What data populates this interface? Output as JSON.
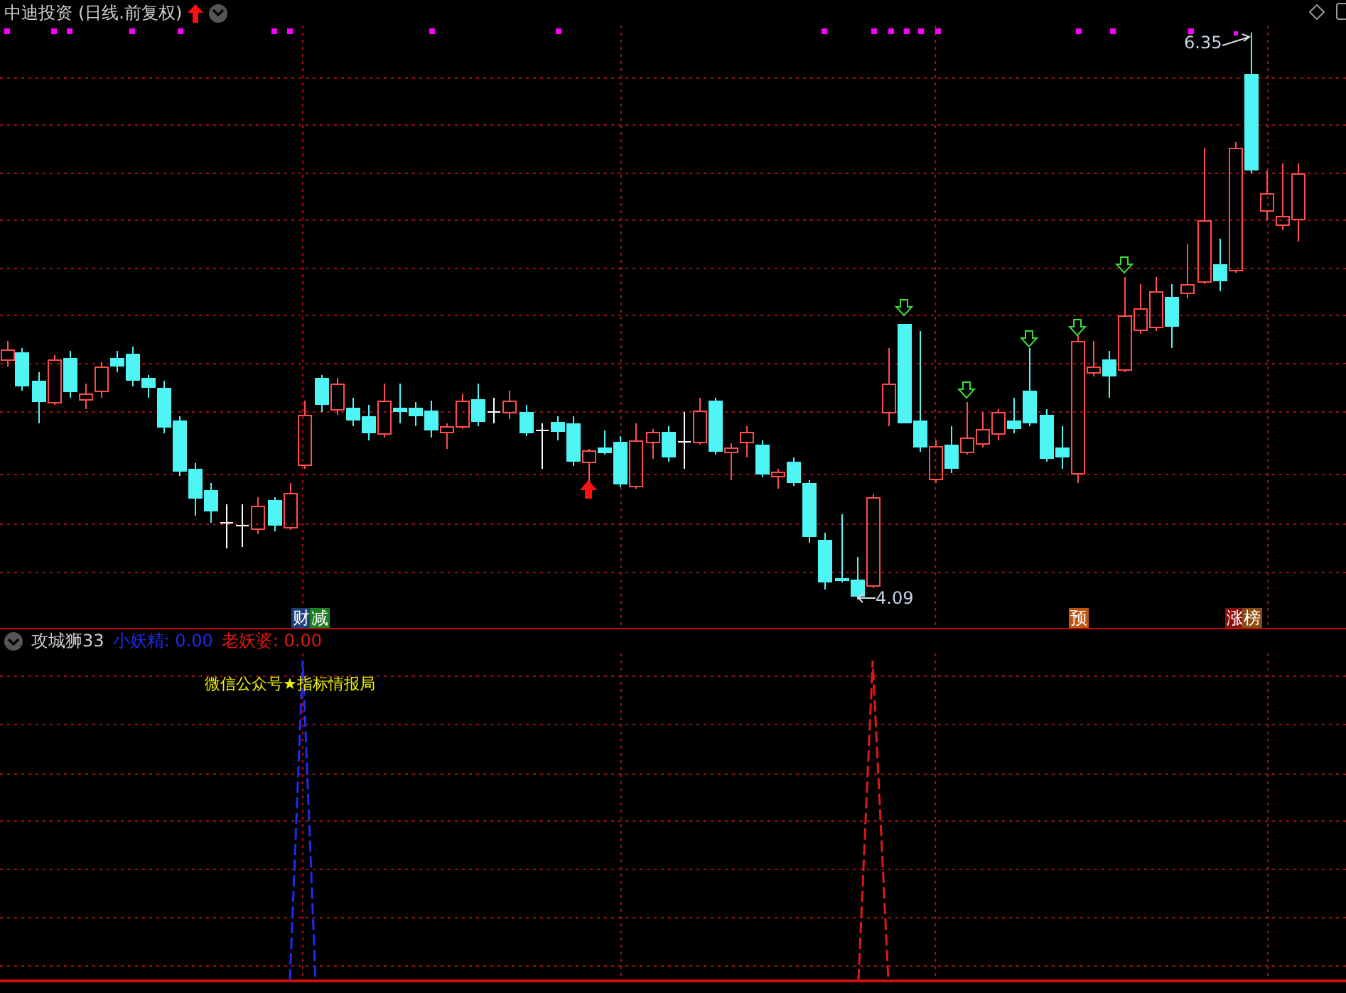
{
  "header": {
    "title": "中迪投资",
    "period": "(日线.前复权)"
  },
  "price_labels": [
    {
      "kind": "high",
      "text": "6.35"
    },
    {
      "kind": "low",
      "text": "4.09"
    }
  ],
  "event_tags": [
    {
      "text": "财",
      "color": "#1c3f78"
    },
    {
      "text": "减",
      "color": "#1f7f23"
    },
    {
      "text": "预",
      "color": "#c2520e"
    },
    {
      "text": "涨",
      "color": "#8e0d0d"
    },
    {
      "text": "榜",
      "color": "#8a4c12"
    }
  ],
  "indicator": {
    "name": "攻城狮33",
    "values": [
      {
        "label": "小妖精:",
        "value": "0.00",
        "color": "#1f2cf0"
      },
      {
        "label": "老妖婆:",
        "value": "0.00",
        "color": "#e01818"
      }
    ],
    "note": "微信公众号★指标情报局"
  }
}
